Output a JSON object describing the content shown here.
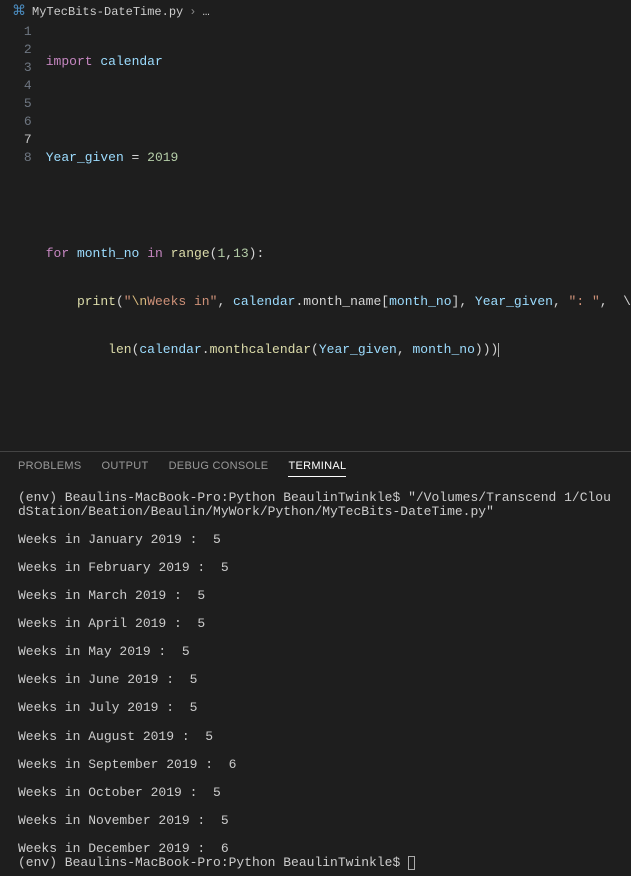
{
  "breadcrumb": {
    "filename": "MyTecBits-DateTime.py",
    "chevron": "›",
    "more": "…"
  },
  "line_numbers": [
    "1",
    "2",
    "3",
    "4",
    "5",
    "6",
    "7",
    "8"
  ],
  "current_line_index": 6,
  "code": {
    "l1": {
      "kw": "import",
      "mod": "calendar"
    },
    "l3": {
      "lhs": "Year_given",
      "eq": " = ",
      "val": "2019"
    },
    "l5": {
      "kw1": "for",
      "var": "month_no",
      "kw2": "in",
      "fn": "range",
      "args_open": "(",
      "a1": "1",
      "comma": ",",
      "a2": "13",
      "args_close": "):"
    },
    "l6": {
      "fn": "print",
      "open": "(",
      "esc": "\\n",
      "str_rest": "Weeks in",
      "comma1": ", ",
      "mod": "calendar",
      "dot": ".month_name[",
      "var": "month_no",
      "close_idx": "], ",
      "var2": "Year_given",
      "comma2": ", ",
      "str2": ": ",
      "tail": ",  \\"
    },
    "l7": {
      "fn": "len",
      "open": "(",
      "mod": "calendar",
      "dot": ".",
      "fn2": "monthcalendar",
      "open2": "(",
      "arg1": "Year_given",
      "comma": ", ",
      "arg2": "month_no",
      "close": ")))"
    }
  },
  "panel_tabs": {
    "problems": "PROBLEMS",
    "output": "OUTPUT",
    "debug": "DEBUG CONSOLE",
    "terminal": "TERMINAL"
  },
  "terminal": {
    "cmd_prefix": "(env) Beaulins-MacBook-Pro:Python BeaulinTwinkle$ ",
    "cmd_path": "\"/Volumes/Transcend 1/CloudStation/Beation/Beaulin/MyWork/Python/MyTecBits-DateTime.py\"",
    "output_lines": [
      "Weeks in January 2019 :  5",
      "Weeks in February 2019 :  5",
      "Weeks in March 2019 :  5",
      "Weeks in April 2019 :  5",
      "Weeks in May 2019 :  5",
      "Weeks in June 2019 :  5",
      "Weeks in July 2019 :  5",
      "Weeks in August 2019 :  5",
      "Weeks in September 2019 :  6",
      "Weeks in October 2019 :  5",
      "Weeks in November 2019 :  5",
      "Weeks in December 2019 :  6"
    ],
    "prompt2": "(env) Beaulins-MacBook-Pro:Python BeaulinTwinkle$ "
  }
}
